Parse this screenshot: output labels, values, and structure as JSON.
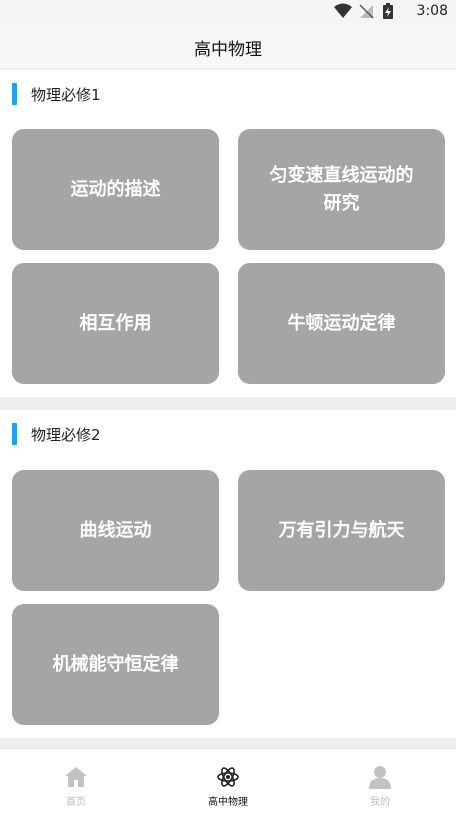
{
  "status_bar": {
    "time": "3:08",
    "icons": [
      "wifi-icon",
      "no-signal-icon",
      "battery-charging-icon"
    ]
  },
  "header": {
    "title": "高中物理"
  },
  "sections": [
    {
      "title": "物理必修1",
      "cards": [
        "运动的描述",
        "匀变速直线运动的研究",
        "相互作用",
        "牛顿运动定律"
      ]
    },
    {
      "title": "物理必修2",
      "cards": [
        "曲线运动",
        "万有引力与航天",
        "机械能守恒定律"
      ]
    }
  ],
  "bottom_nav": {
    "items": [
      {
        "label": "首页",
        "icon": "home-icon",
        "active": false
      },
      {
        "label": "高中物理",
        "icon": "atom-icon",
        "active": true
      },
      {
        "label": "我的",
        "icon": "user-icon",
        "active": false
      }
    ],
    "active_color": "#111111",
    "inactive_color": "#bdbdbd"
  },
  "colors": {
    "accent": "#1aa3ef",
    "card_bg": "#a5a5a5",
    "page_bg": "#efefef"
  }
}
